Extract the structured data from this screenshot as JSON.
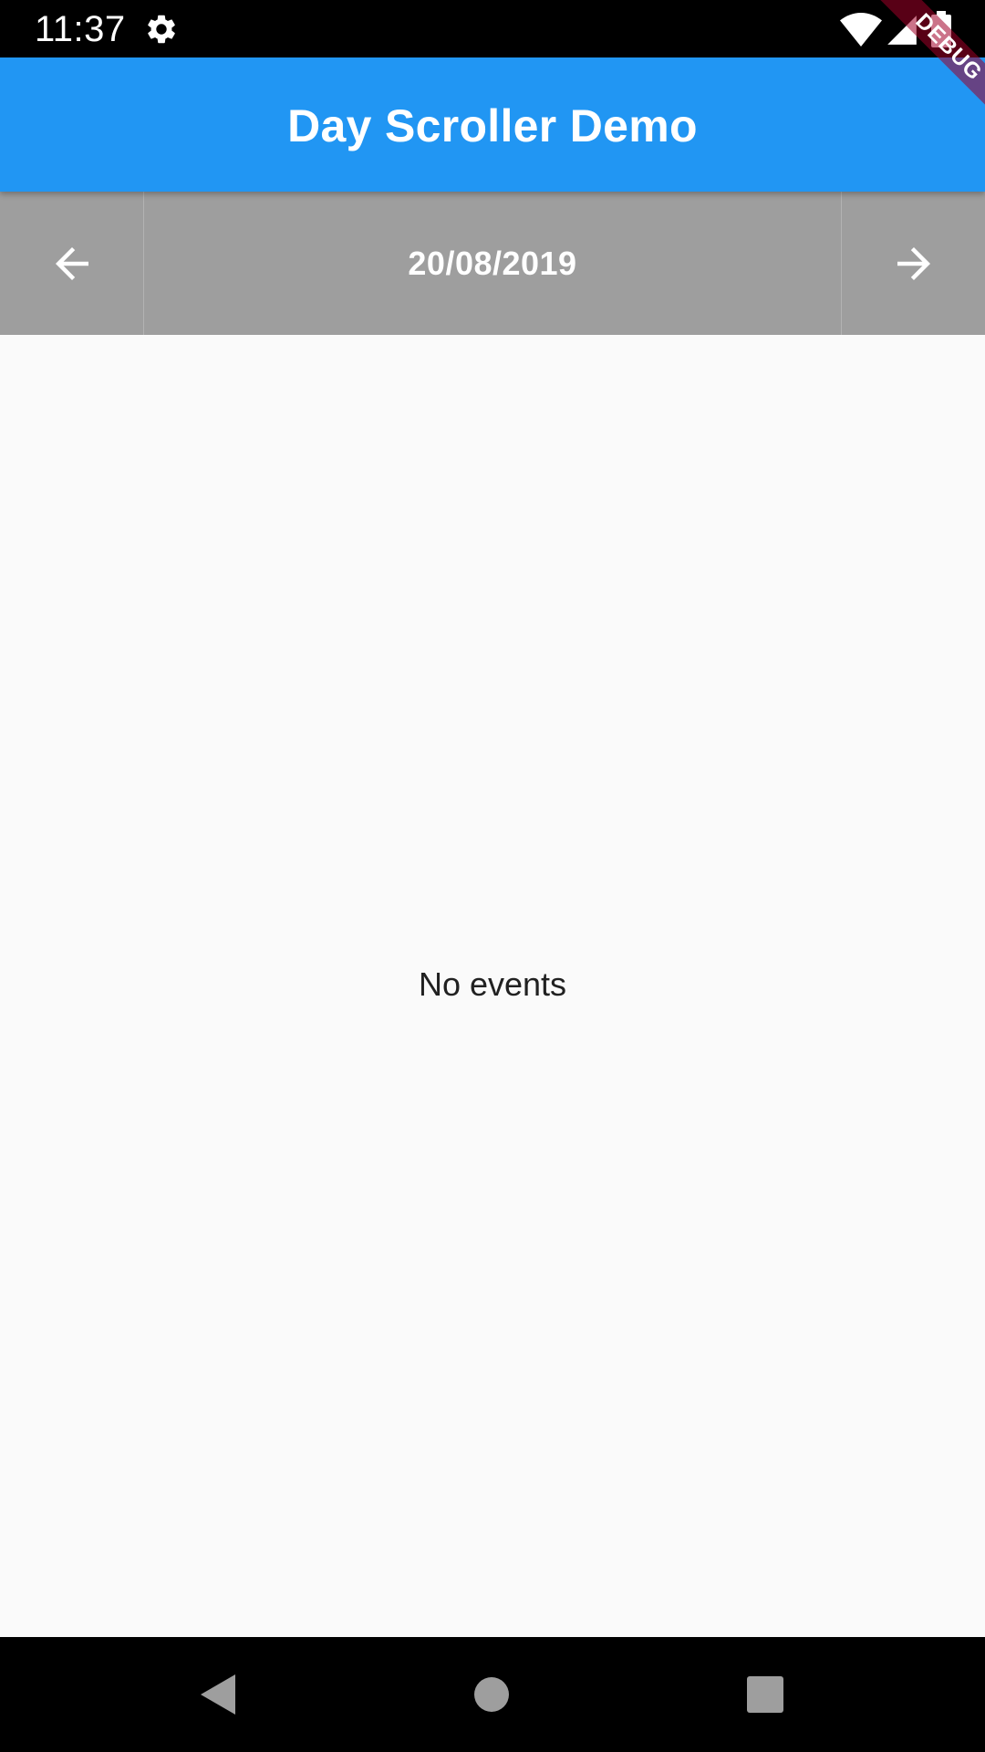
{
  "status_bar": {
    "time": "11:37",
    "icons": [
      "gear-icon",
      "wifi-icon",
      "signal-icon",
      "battery-icon"
    ]
  },
  "app_bar": {
    "title": "Day Scroller Demo"
  },
  "day_scroller": {
    "prev_icon": "arrow-left-icon",
    "date": "20/08/2019",
    "next_icon": "arrow-right-icon"
  },
  "content": {
    "empty_text": "No events"
  },
  "debug_banner": {
    "label": "DEBUG"
  },
  "nav_bar": {
    "icons": [
      "back-triangle-icon",
      "home-circle-icon",
      "recents-square-icon"
    ]
  },
  "colors": {
    "app_bar": "#2196f3",
    "day_scroller": "#9e9e9e",
    "background": "#fafafa",
    "debug_banner": "#a00028"
  }
}
